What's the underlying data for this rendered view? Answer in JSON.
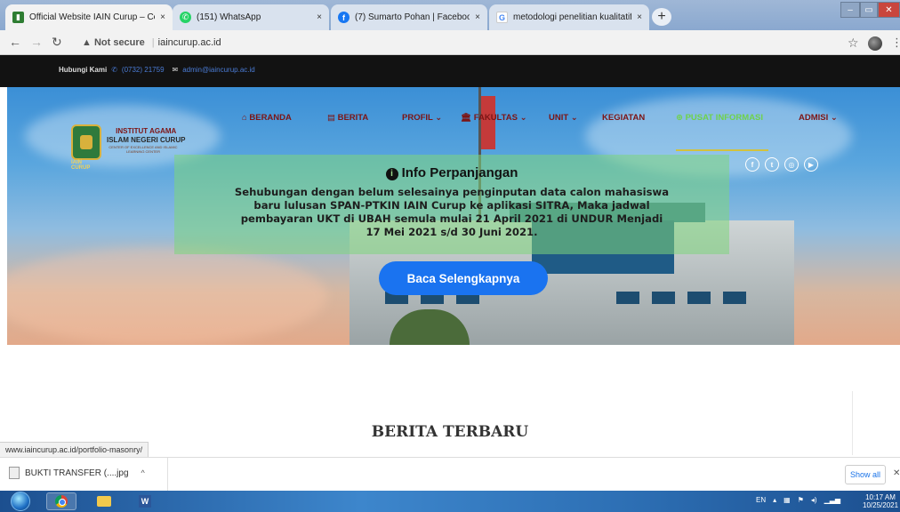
{
  "browser": {
    "tabs": [
      {
        "title": "Official Website IAIN Curup – Ce",
        "close": "×",
        "favicon_color": "#2e7d32"
      },
      {
        "title": "(151) WhatsApp",
        "close": "×",
        "favicon_color": "#25d366"
      },
      {
        "title": "(7) Sumarto Pohan | Facebook",
        "close": "×",
        "favicon_color": "#1877f2"
      },
      {
        "title": "metodologi penelitian kualitatif -",
        "close": "×",
        "favicon_color": "#4285f4"
      }
    ],
    "new_tab": "+",
    "address": {
      "warning": "▲ Not secure",
      "url": "iaincurup.ac.id"
    }
  },
  "site": {
    "topbar": {
      "label": "Hubungi Kami",
      "phone": "(0732) 21759",
      "email": "admin@iaincurup.ac.id"
    },
    "logo": {
      "line1": "INSTITUT AGAMA",
      "line2": "ISLAM NEGERI CURUP",
      "tagline": "CENTER OF EXCELLENCE AND ISLAMIC LEARNING CENTER",
      "badge": "IAIN CURUP"
    },
    "menu": [
      {
        "label": "⌂ BERANDA"
      },
      {
        "label": "▤ BERITA"
      },
      {
        "label": "PROFIL ⌄"
      },
      {
        "label": "🏛 FAKULTAS ⌄"
      },
      {
        "label": "UNIT ⌄"
      },
      {
        "label": "KEGIATAN"
      },
      {
        "label": "⊕ PUSAT INFORMASI"
      },
      {
        "label": "ADMISI ⌄"
      }
    ],
    "socials": [
      "f",
      "t",
      "◎",
      "▶"
    ],
    "info": {
      "title": "Info Perpanjangan",
      "lines": [
        "Sehubungan dengan belum selesainya penginputan data calon mahasiswa",
        "baru lulusan SPAN-PTKIN IAIN Curup ke aplikasi SITRA, Maka jadwal",
        "pembayaran UKT di UBAH semula mulai 21 April 2021 di UNDUR Menjadi",
        "17 Mei 2021 s/d 30 Juni 2021."
      ],
      "cta": "Baca Selengkapnya"
    },
    "section_heading": "BERITA TERBARU"
  },
  "status_url": "www.iaincurup.ac.id/portfolio-masonry/",
  "downloads": {
    "item": "BUKTI TRANSFER (....jpg",
    "caret": "^",
    "show_all": "Show all"
  },
  "taskbar": {
    "tray_lang": "EN",
    "time": "10:17 AM",
    "date": "10/25/2021"
  },
  "colors": {
    "menu": "#7c1515",
    "menu_active": "#6fd24a",
    "cta": "#1a73f0",
    "info_box": "#7ed67c"
  }
}
